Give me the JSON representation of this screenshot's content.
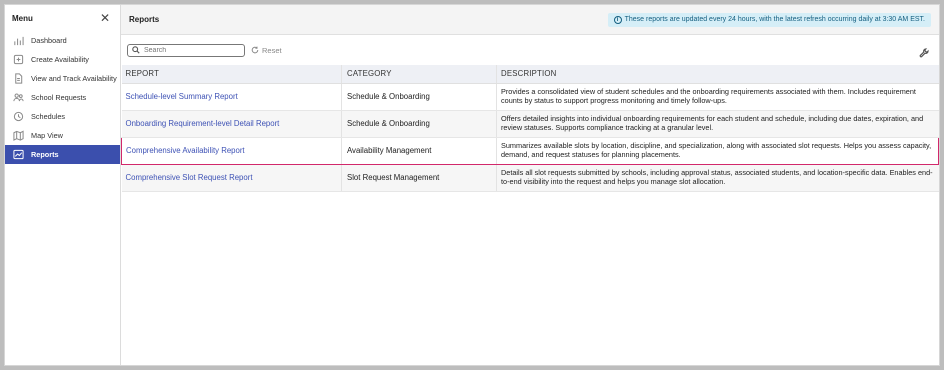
{
  "sidebar": {
    "title": "Menu",
    "close_icon": "close-icon",
    "items": [
      {
        "label": "Dashboard",
        "icon": "bar-chart-icon"
      },
      {
        "label": "Create Availability",
        "icon": "plus-square-icon"
      },
      {
        "label": "View and Track Availability",
        "icon": "document-icon"
      },
      {
        "label": "School Requests",
        "icon": "users-icon"
      },
      {
        "label": "Schedules",
        "icon": "clock-icon"
      },
      {
        "label": "Map View",
        "icon": "map-icon"
      },
      {
        "label": "Reports",
        "icon": "trend-chart-icon",
        "active": true
      }
    ]
  },
  "header": {
    "title": "Reports",
    "notice": "These reports are updated every 24 hours, with the latest refresh occurring daily at 3:30 AM EST."
  },
  "toolbar": {
    "search_placeholder": "Search",
    "reset_label": "Reset"
  },
  "table": {
    "headers": {
      "report": "REPORT",
      "category": "CATEGORY",
      "description": "DESCRIPTION"
    },
    "rows": [
      {
        "report": "Schedule-level Summary Report",
        "category": "Schedule & Onboarding",
        "description": "Provides a consolidated view of student schedules and the onboarding requirements associated with them. Includes requirement counts by status to support progress monitoring and timely follow-ups."
      },
      {
        "report": "Onboarding Requirement-level Detail Report",
        "category": "Schedule & Onboarding",
        "description": "Offers detailed insights into individual onboarding requirements for each student and schedule, including due dates, expiration, and review statuses. Supports compliance tracking at a granular level."
      },
      {
        "report": "Comprehensive Availability Report",
        "category": "Availability Management",
        "description": "Summarizes available slots by location, discipline, and specialization, along with associated slot requests. Helps you assess capacity, demand, and request statuses for planning placements."
      },
      {
        "report": "Comprehensive Slot Request Report",
        "category": "Slot Request Management",
        "description": "Details all slot requests submitted by schools, including approval status, associated students, and location-specific data. Enables end-to-end visibility into the request and helps you manage slot allocation."
      }
    ]
  },
  "colors": {
    "accent": "#3b4fad",
    "link": "#3e52b5",
    "highlight_border": "#d2286b",
    "notice_bg": "#d5eef7"
  }
}
